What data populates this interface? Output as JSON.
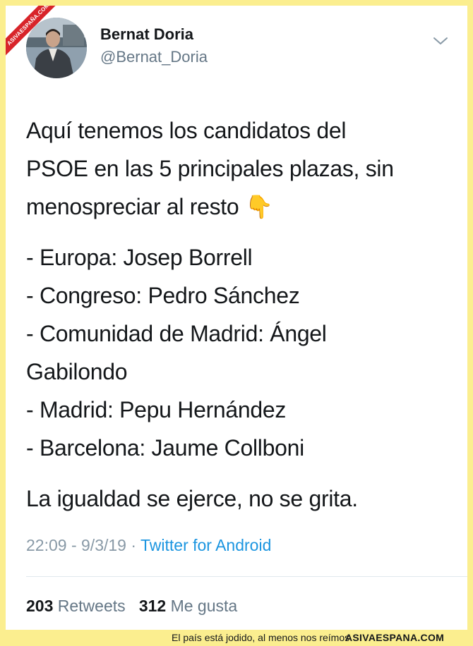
{
  "watermark": {
    "ribbon_text": "ASIVAESPAÑA.COM"
  },
  "tweet": {
    "author_name": "Bernat Doria",
    "author_handle": "@Bernat_Doria",
    "lines": [
      "Aquí tenemos los candidatos del",
      "PSOE en las 5 principales plazas, sin",
      "menospreciar al resto 👇",
      "- Europa: Josep Borrell",
      "- Congreso: Pedro Sánchez",
      "- Comunidad de Madrid: Ángel",
      "Gabilondo",
      "- Madrid: Pepu Hernández",
      "- Barcelona: Jaume Collboni",
      "La igualdad se ejerce, no se grita."
    ],
    "time": "22:09",
    "date": "9/3/19",
    "source": "Twitter for Android",
    "retweets_count": "203",
    "retweets_label": "Retweets",
    "likes_count": "312",
    "likes_label": "Me gusta"
  },
  "footer": {
    "tagline": "El país está jodido, al menos nos reímos",
    "brand": "ASIVAESPANA.COM"
  }
}
